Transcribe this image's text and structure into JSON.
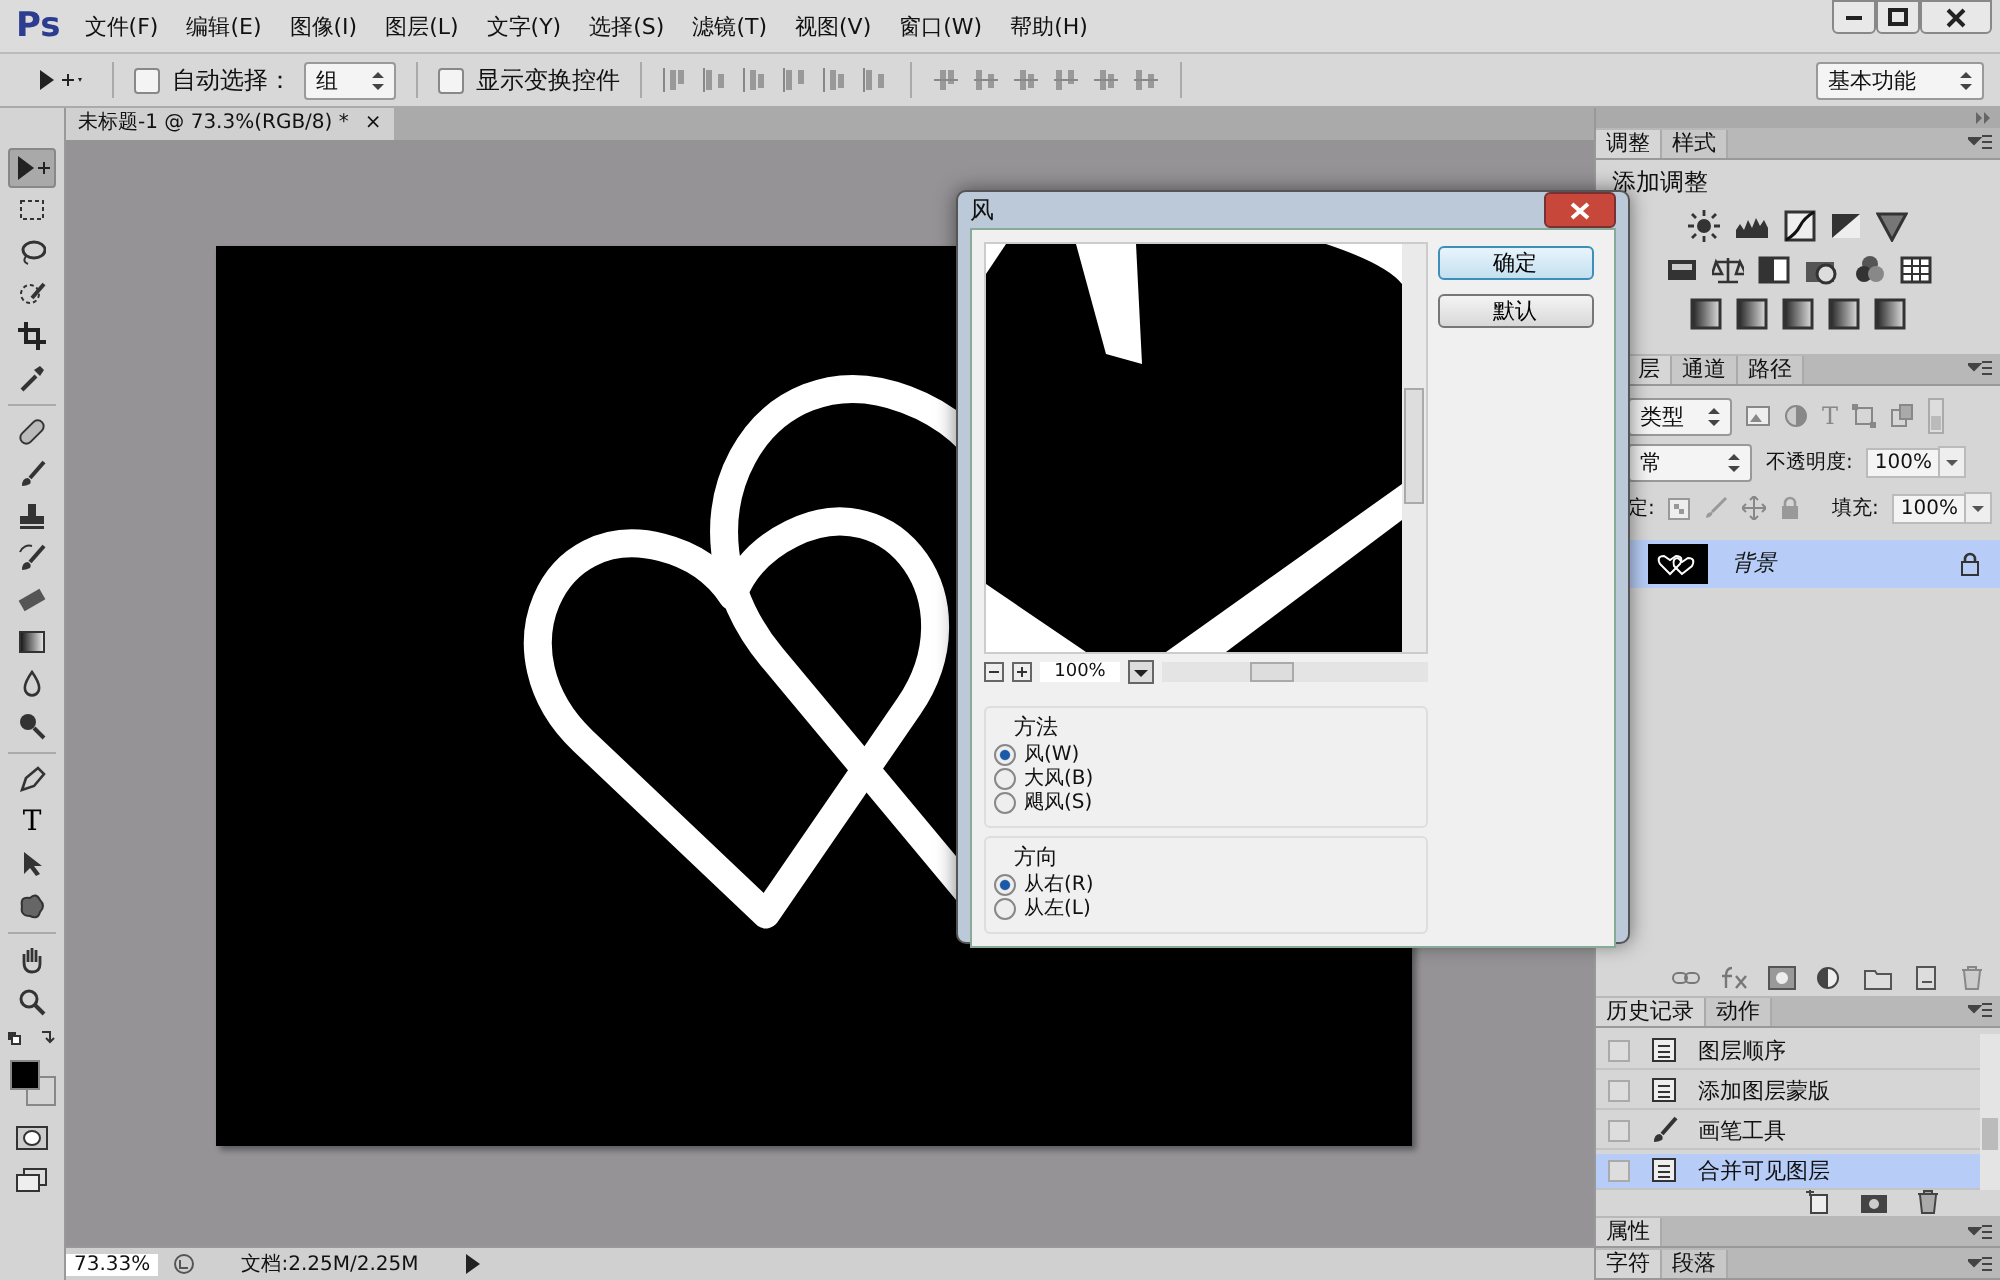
{
  "app": {
    "logo": "Ps",
    "menus": [
      "文件(F)",
      "编辑(E)",
      "图像(I)",
      "图层(L)",
      "文字(Y)",
      "选择(S)",
      "滤镜(T)",
      "视图(V)",
      "窗口(W)",
      "帮助(H)"
    ]
  },
  "options_bar": {
    "auto_select": {
      "label": "自动选择：",
      "checked": false
    },
    "auto_select_target": "组",
    "show_transform": {
      "label": "显示变换控件",
      "checked": false
    },
    "workspace": "基本功能"
  },
  "document_tab": {
    "title": "未标题-1 @ 73.3%(RGB/8) *",
    "close": "×"
  },
  "tools": [
    {
      "kind": "move",
      "selected": true
    },
    {
      "kind": "marquee",
      "selected": false
    },
    {
      "kind": "lasso",
      "selected": false
    },
    {
      "kind": "quick-select",
      "selected": false
    },
    {
      "kind": "crop",
      "selected": false
    },
    {
      "kind": "eyedropper",
      "selected": false
    },
    {
      "kind": "heal",
      "selected": false
    },
    {
      "kind": "brush",
      "selected": false
    },
    {
      "kind": "stamp",
      "selected": false
    },
    {
      "kind": "history-brush",
      "selected": false
    },
    {
      "kind": "eraser",
      "selected": false
    },
    {
      "kind": "gradient",
      "selected": false
    },
    {
      "kind": "blur",
      "selected": false
    },
    {
      "kind": "dodge",
      "selected": false
    },
    {
      "kind": "pen",
      "selected": false
    },
    {
      "kind": "type",
      "glyph": "T",
      "selected": false
    },
    {
      "kind": "path-select",
      "selected": false
    },
    {
      "kind": "shape",
      "selected": false
    },
    {
      "kind": "hand",
      "selected": false
    },
    {
      "kind": "zoom",
      "selected": false
    }
  ],
  "dialog": {
    "title": "风",
    "buttons": [
      {
        "label": "确定",
        "default": true
      },
      {
        "label": "默认",
        "default": false
      }
    ],
    "zoom": "100%",
    "groups": [
      {
        "title": "方法",
        "options": [
          {
            "label": "风(W)",
            "selected": true
          },
          {
            "label": "大风(B)",
            "selected": false
          },
          {
            "label": "飓风(S)",
            "selected": false
          }
        ]
      },
      {
        "title": "方向",
        "options": [
          {
            "label": "从右(R)",
            "selected": true
          },
          {
            "label": "从左(L)",
            "selected": false
          }
        ]
      }
    ]
  },
  "adjustments": {
    "tabs": [
      {
        "label": "调整",
        "selected": true
      },
      {
        "label": "样式",
        "selected": false
      }
    ],
    "heading": "添加调整"
  },
  "layers": {
    "tabs": [
      {
        "label": "层",
        "selected": true
      },
      {
        "label": "通道",
        "selected": false
      },
      {
        "label": "路径",
        "selected": false
      }
    ],
    "filter": "类型",
    "type_glyph": "T",
    "blend_mode": "常",
    "opacity_label": "不透明度:",
    "opacity": "100%",
    "lock_label": "定:",
    "fill_label": "填充:",
    "fill": "100%",
    "items": [
      {
        "name": "背景",
        "selected": true,
        "locked": true
      }
    ]
  },
  "history": {
    "tabs": [
      {
        "label": "历史记录",
        "selected": true
      },
      {
        "label": "动作",
        "selected": false
      }
    ],
    "items": [
      {
        "label": "图层顺序",
        "kind": "document",
        "selected": false
      },
      {
        "label": "添加图层蒙版",
        "kind": "document",
        "selected": false
      },
      {
        "label": "画笔工具",
        "kind": "brush",
        "selected": false
      },
      {
        "label": "合并可见图层",
        "kind": "document",
        "selected": true
      }
    ]
  },
  "properties": {
    "tabs": [
      {
        "label": "属性",
        "selected": true
      }
    ]
  },
  "character": {
    "tabs": [
      {
        "label": "字符",
        "selected": true
      },
      {
        "label": "段落",
        "selected": false
      }
    ]
  },
  "status": {
    "zoom": "73.33%",
    "doc": "文档:2.25M/2.25M"
  }
}
